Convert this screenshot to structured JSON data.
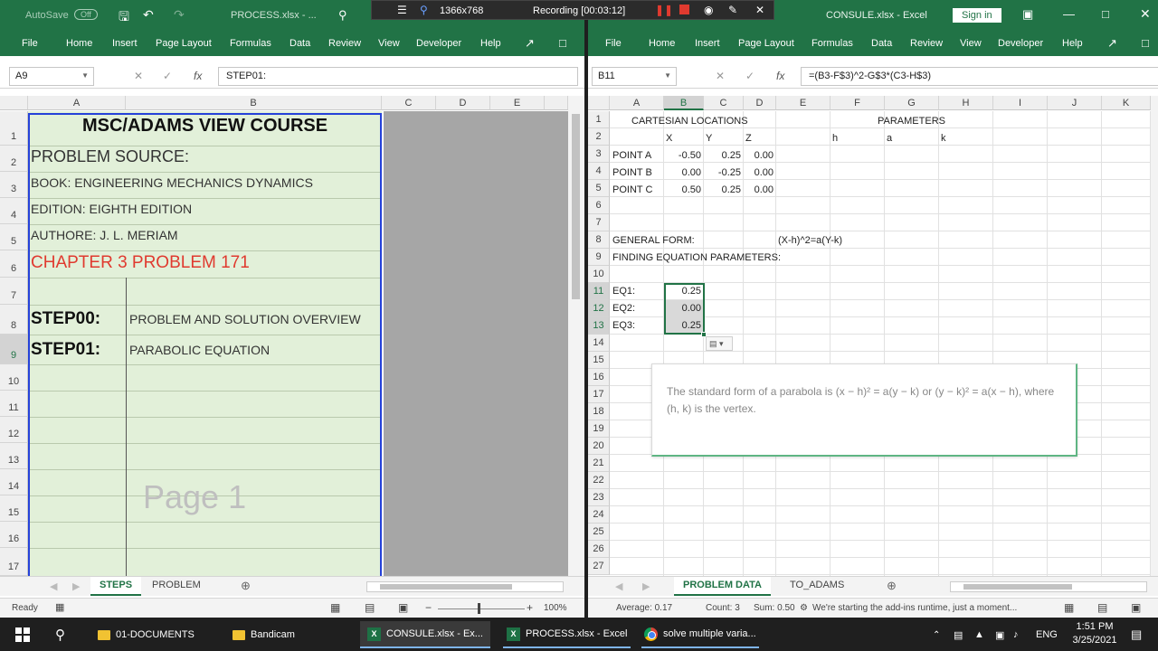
{
  "recorder": {
    "resolution": "1366x768",
    "status": "Recording [00:03:12]"
  },
  "left": {
    "autosave_label": "AutoSave",
    "autosave_state": "Off",
    "title": "PROCESS.xlsx - ...",
    "menu": [
      "File",
      "Home",
      "Insert",
      "Page Layout",
      "Formulas",
      "Data",
      "Review",
      "View",
      "Developer",
      "Help"
    ],
    "namebox": "A9",
    "formula": "STEP01:",
    "columns": [
      "A",
      "B",
      "C",
      "D",
      "E"
    ],
    "rows": [
      "1",
      "2",
      "3",
      "4",
      "5",
      "6",
      "7",
      "8",
      "9",
      "10",
      "11",
      "12",
      "13",
      "14",
      "15",
      "16",
      "17"
    ],
    "cells": {
      "r1": "MSC/ADAMS VIEW COURSE",
      "r2": "PROBLEM SOURCE:",
      "r3": "BOOK: ENGINEERING MECHANICS DYNAMICS",
      "r4": "EDITION: EIGHTH EDITION",
      "r5": "AUTHORE: J. L. MERIAM",
      "r6": "CHAPTER 3 PROBLEM 171",
      "r8a": "STEP00:",
      "r8b": "PROBLEM AND SOLUTION OVERVIEW",
      "r9a": "STEP01:",
      "r9b": "PARABOLIC EQUATION"
    },
    "watermark": "Page 1",
    "tabs": [
      "STEPS",
      "PROBLEM"
    ],
    "status": "Ready",
    "zoom": "100%"
  },
  "right": {
    "title": "CONSULE.xlsx - Excel",
    "signin": "Sign in",
    "menu": [
      "File",
      "Home",
      "Insert",
      "Page Layout",
      "Formulas",
      "Data",
      "Review",
      "View",
      "Developer",
      "Help"
    ],
    "namebox": "B11",
    "formula": "=(B3-F$3)^2-G$3*(C3-H$3)",
    "columns": [
      "A",
      "B",
      "C",
      "D",
      "E",
      "F",
      "G",
      "H",
      "I",
      "J",
      "K"
    ],
    "rows": [
      "1",
      "2",
      "3",
      "4",
      "5",
      "6",
      "7",
      "8",
      "9",
      "10",
      "11",
      "12",
      "13",
      "14",
      "15",
      "16",
      "17",
      "18",
      "19",
      "20",
      "21",
      "22",
      "23",
      "24",
      "25",
      "26",
      "27"
    ],
    "cells": {
      "cartesian": "CARTESIAN LOCATIONS",
      "parameters": "PARAMETERS",
      "x": "X",
      "y": "Y",
      "z": "Z",
      "h": "h",
      "a": "a",
      "k": "k",
      "pa": "POINT A",
      "pa_x": "-0.50",
      "pa_y": "0.25",
      "pa_z": "0.00",
      "pb": "POINT B",
      "pb_x": "0.00",
      "pb_y": "-0.25",
      "pb_z": "0.00",
      "pc": "POINT C",
      "pc_x": "0.50",
      "pc_y": "0.25",
      "pc_z": "0.00",
      "gf": "GENERAL FORM:",
      "gf_eq": "(X-h)^2=a(Y-k)",
      "fe": "FINDING EQUATION PARAMETERS:",
      "eq1": "EQ1:",
      "eq1_v": "0.25",
      "eq2": "EQ2:",
      "eq2_v": "0.00",
      "eq3": "EQ3:",
      "eq3_v": "0.25"
    },
    "tooltip": "The standard form of a parabola is (x − h)² = a(y − k) or (y − k)² = a(x − h), where (h, k) is the vertex.",
    "tabs": [
      "PROBLEM DATA",
      "TO_ADAMS"
    ],
    "status_avg": "Average: 0.17",
    "status_count": "Count: 3",
    "status_sum": "Sum: 0.50",
    "status_msg": "We're starting the add-ins runtime, just a moment..."
  },
  "taskbar": {
    "items": [
      "01-DOCUMENTS",
      "Bandicam",
      "CONSULE.xlsx - Ex...",
      "PROCESS.xlsx - Excel",
      "solve multiple varia..."
    ],
    "lang": "ENG",
    "time": "1:51 PM",
    "date": "3/25/2021"
  }
}
